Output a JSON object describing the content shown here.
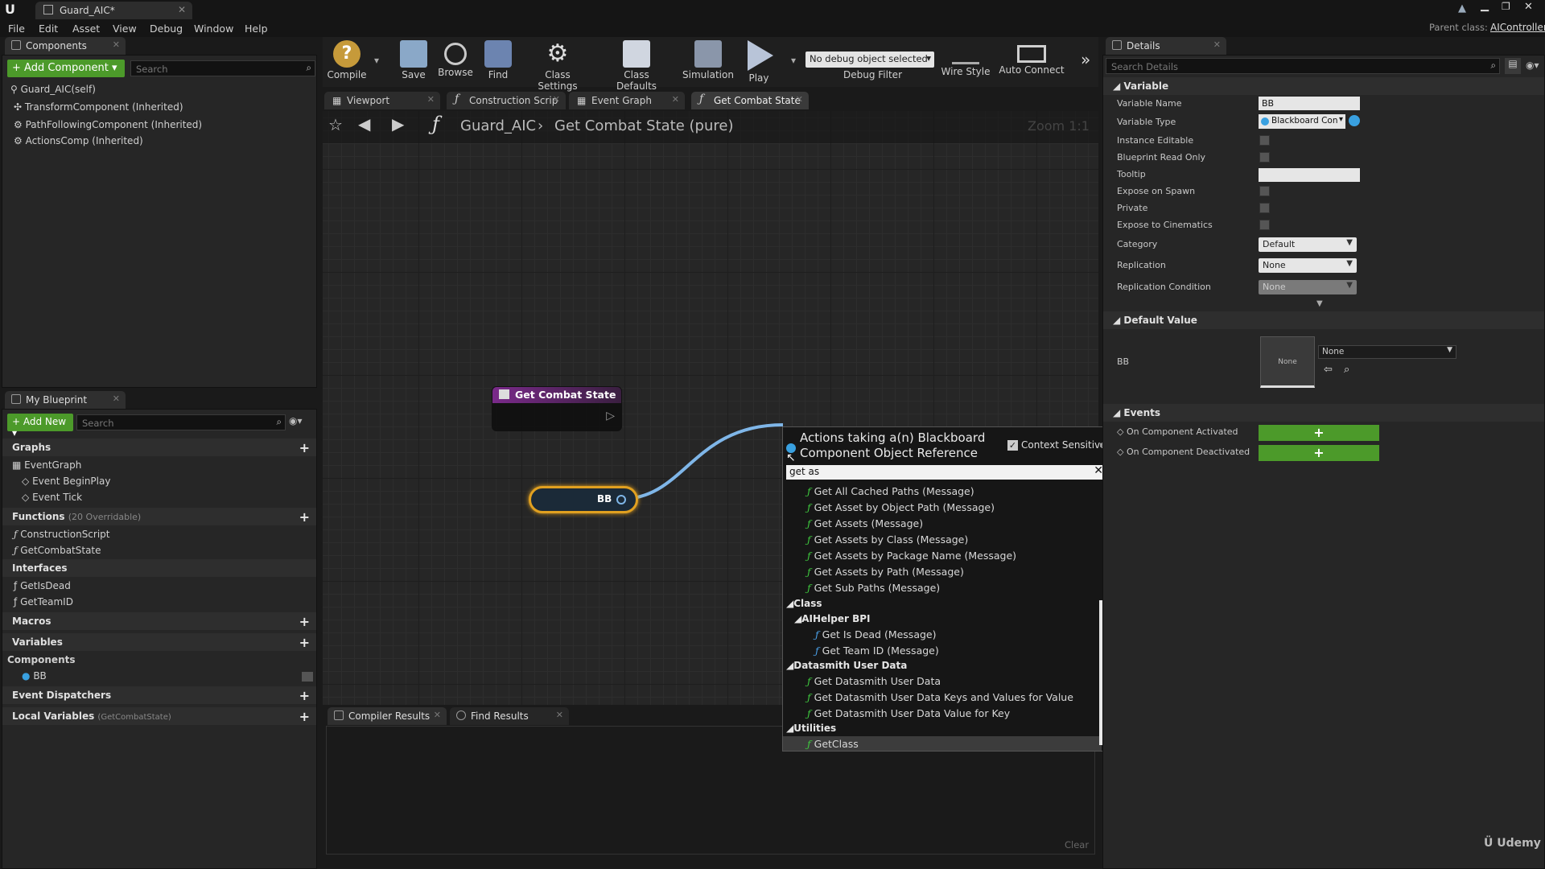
{
  "window": {
    "doc_tab": "Guard_AIC*",
    "parent_class_label": "Parent class:",
    "parent_class_value": "AIController"
  },
  "menu": [
    "File",
    "Edit",
    "Asset",
    "View",
    "Debug",
    "Window",
    "Help"
  ],
  "components_panel": {
    "tab": "Components",
    "add_label": "+ Add Component",
    "search_placeholder": "Search",
    "items": [
      "Guard_AIC(self)",
      "TransformComponent (Inherited)",
      "PathFollowingComponent (Inherited)",
      "ActionsComp (Inherited)"
    ]
  },
  "my_blueprint": {
    "tab": "My Blueprint",
    "add_new": "+ Add New",
    "search_placeholder": "Search",
    "graphs_label": "Graphs",
    "event_graph": "EventGraph",
    "events": [
      "Event BeginPlay",
      "Event Tick"
    ],
    "functions_label": "Functions",
    "functions_count": "(20 Overridable)",
    "functions": [
      "ConstructionScript",
      "GetCombatState"
    ],
    "interfaces_label": "Interfaces",
    "interfaces": [
      "GetIsDead",
      "GetTeamID"
    ],
    "macros_label": "Macros",
    "variables_label": "Variables",
    "components_label": "Components",
    "bb_var": "BB",
    "dispatchers_label": "Event Dispatchers",
    "local_vars_label": "Local Variables",
    "local_vars_scope": "(GetCombatState)"
  },
  "toolbar": {
    "compile": "Compile",
    "save": "Save",
    "browse": "Browse",
    "find": "Find",
    "class_settings": "Class Settings",
    "class_defaults": "Class Defaults",
    "simulation": "Simulation",
    "play": "Play",
    "debug_select": "No debug object selected",
    "debug_filter": "Debug Filter",
    "wire_style": "Wire Style",
    "auto_connect": "Auto Connect"
  },
  "graph_tabs": [
    "Viewport",
    "Construction Scrip",
    "Event Graph",
    "Get Combat State"
  ],
  "breadcrumb": {
    "root": "Guard_AIC",
    "current": "Get Combat State (pure)",
    "zoom": "Zoom 1:1"
  },
  "nodes": {
    "entry_title": "Get Combat State",
    "var_node": "BB"
  },
  "bottom_tabs": [
    "Compiler Results",
    "Find Results"
  ],
  "bottom_clear": "Clear",
  "action_menu": {
    "title_line1": "Actions taking a(n) Blackboard",
    "title_line2": "Component Object Reference",
    "context_sensitive": "Context Sensitive",
    "query": "get as",
    "items_top": [
      "Get All Cached Paths (Message)",
      "Get Asset by Object Path (Message)",
      "Get Assets (Message)",
      "Get Assets by Class (Message)",
      "Get Assets by Package Name (Message)",
      "Get Assets by Path (Message)",
      "Get Sub Paths (Message)"
    ],
    "cat_class": "Class",
    "cat_aihelper": "AIHelper BPI",
    "aihelper_items": [
      "Get Is Dead (Message)",
      "Get Team ID (Message)"
    ],
    "cat_datasmith": "Datasmith User Data",
    "datasmith_items": [
      "Get Datasmith User Data",
      "Get Datasmith User Data Keys and Values for Value",
      "Get Datasmith User Data Value for Key"
    ],
    "cat_utilities": "Utilities",
    "utilities_items": [
      "GetClass"
    ]
  },
  "details": {
    "tab": "Details",
    "search_placeholder": "Search Details",
    "variable_section": "Variable",
    "rows": {
      "variable_name": "Variable Name",
      "variable_type": "Variable Type",
      "instance_editable": "Instance Editable",
      "bp_read_only": "Blueprint Read Only",
      "tooltip": "Tooltip",
      "expose_on_spawn": "Expose on Spawn",
      "private": "Private",
      "expose_cinematics": "Expose to Cinematics",
      "category": "Category",
      "replication": "Replication",
      "replication_condition": "Replication Condition"
    },
    "values": {
      "variable_name": "BB",
      "variable_type": "Blackboard Con",
      "category": "Default",
      "replication": "None",
      "replication_condition": "None"
    },
    "default_value_section": "Default Value",
    "default_bb": "BB",
    "thumb_none": "None",
    "asset_select": "None",
    "events_section": "Events",
    "events": [
      "On Component Activated",
      "On Component Deactivated"
    ]
  },
  "watermark": "Udemy",
  "colors": {
    "accent_green": "#4c9a2a",
    "wire": "#7fb6e8",
    "node_title": "#7a2a8a",
    "var_node_border": "#e0a020"
  }
}
